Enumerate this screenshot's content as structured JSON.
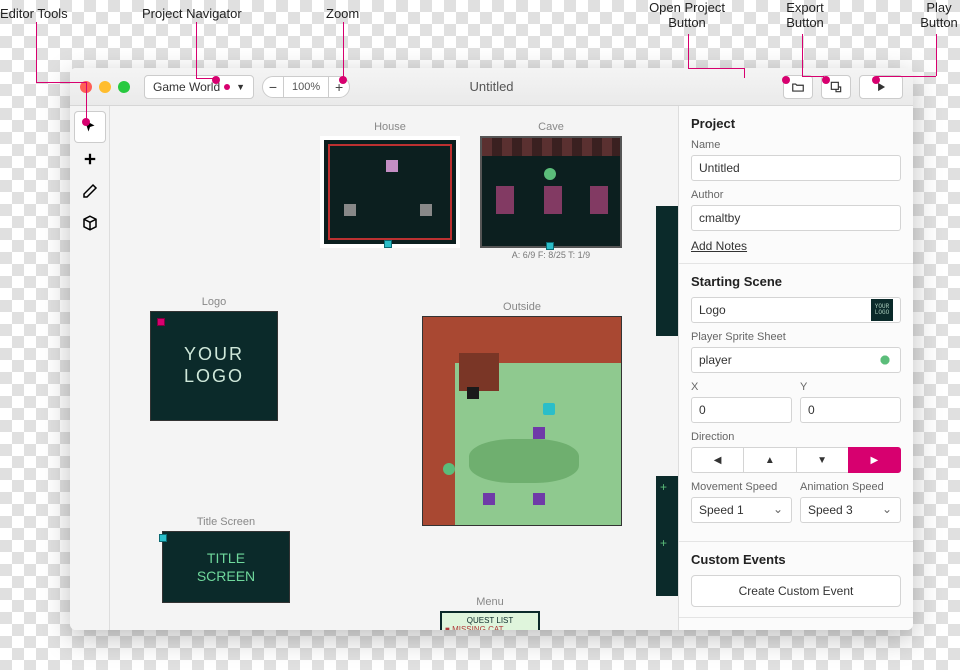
{
  "annotations": {
    "editor_tools": "Editor Tools",
    "project_navigator": "Project Navigator",
    "zoom": "Zoom",
    "open_project": "Open Project\nButton",
    "export": "Export\nButton",
    "play": "Play\nButton"
  },
  "titlebar": {
    "navigator_value": "Game World",
    "zoom_pct": "100%",
    "window_title": "Untitled"
  },
  "scenes": {
    "house": "House",
    "cave": "Cave",
    "cave_info": "A: 6/9   F: 8/25   T: 1/9",
    "logo": "Logo",
    "logo_text": "YOUR\nLOGO",
    "outside": "Outside",
    "title_screen": "Title Screen",
    "title_text": "TITLE\nSCREEN",
    "menu": "Menu",
    "menu_title": "QUEST LIST",
    "menu_item": "MISSING CAT"
  },
  "sidebar": {
    "project_heading": "Project",
    "name_label": "Name",
    "name_value": "Untitled",
    "author_label": "Author",
    "author_value": "cmaltby",
    "add_notes": "Add Notes",
    "starting_heading": "Starting Scene",
    "starting_value": "Logo",
    "sprite_label": "Player Sprite Sheet",
    "sprite_value": "player",
    "x_label": "X",
    "x_value": "0",
    "y_label": "Y",
    "y_value": "0",
    "direction_label": "Direction",
    "move_speed_label": "Movement Speed",
    "move_speed_value": "Speed 1",
    "anim_speed_label": "Animation Speed",
    "anim_speed_value": "Speed 3",
    "custom_heading": "Custom Events",
    "create_event": "Create Custom Event",
    "logo_thumb": "YOUR\nLOGO"
  }
}
